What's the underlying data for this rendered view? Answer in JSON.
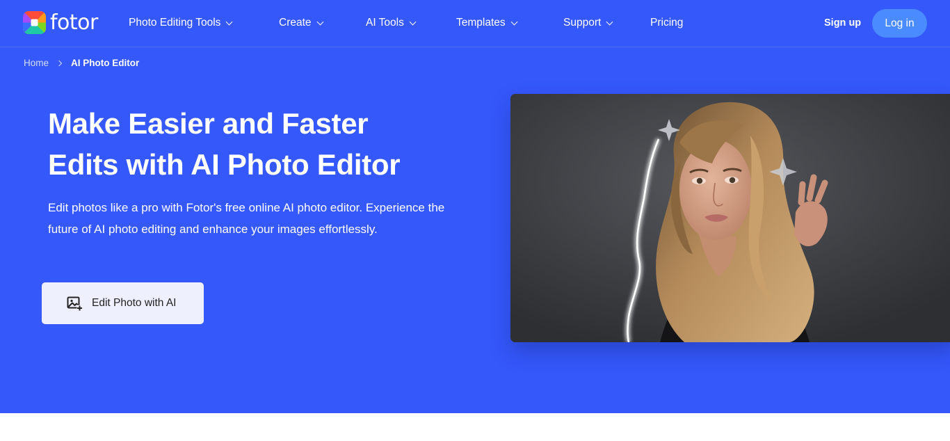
{
  "brand": {
    "name": "fotor"
  },
  "nav": {
    "items": [
      {
        "label": "Photo Editing Tools",
        "has_dropdown": true
      },
      {
        "label": "Create",
        "has_dropdown": true
      },
      {
        "label": "AI Tools",
        "has_dropdown": true
      },
      {
        "label": "Templates",
        "has_dropdown": true
      },
      {
        "label": "Support",
        "has_dropdown": true
      },
      {
        "label": "Pricing",
        "has_dropdown": false
      }
    ],
    "signup_label": "Sign up",
    "login_label": "Log in"
  },
  "breadcrumb": {
    "home": "Home",
    "current": "AI Photo Editor"
  },
  "hero": {
    "title_line1": "Make Easier and Faster",
    "title_line2": "Edits with AI Photo Editor",
    "description": "Edit photos like a pro with Fotor's free online AI photo editor. Experience the future of AI photo editing and enhance your images effortlessly.",
    "cta_label": "Edit Photo with AI",
    "cta_icon": "image-add-icon"
  },
  "colors": {
    "hero_bg": "#3558fb",
    "login_bg": "#4a8bff",
    "cta_bg": "#eef1fd",
    "page_bg": "#ffffff"
  }
}
